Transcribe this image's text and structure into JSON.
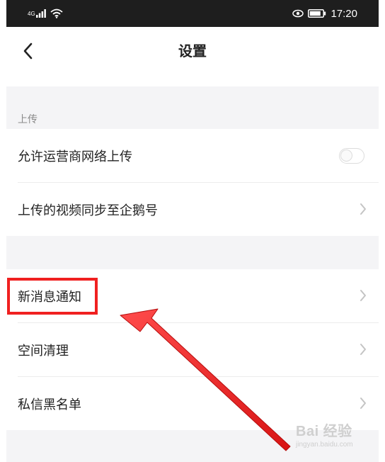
{
  "status_bar": {
    "signal_label": "4G",
    "time": "17:20"
  },
  "nav": {
    "title": "设置",
    "back_icon": "chevron-left-icon"
  },
  "sections": [
    {
      "header": "上传",
      "items": [
        {
          "label": "允许运营商网络上传",
          "control": "toggle",
          "toggle_on": false
        },
        {
          "label": "上传的视频同步至企鹅号",
          "control": "chevron"
        }
      ]
    },
    {
      "header": "",
      "items": [
        {
          "label": "新消息通知",
          "control": "chevron",
          "highlighted": true
        },
        {
          "label": "空间清理",
          "control": "chevron"
        },
        {
          "label": "私信黑名单",
          "control": "chevron"
        }
      ]
    }
  ],
  "watermark": {
    "brand": "Bai 经验",
    "url": "jingyan.baidu.com"
  },
  "colors": {
    "annotation_red": "#f02020",
    "section_bg": "#f4f4f6",
    "text_primary": "#222222",
    "text_secondary": "#8a8a8a"
  }
}
